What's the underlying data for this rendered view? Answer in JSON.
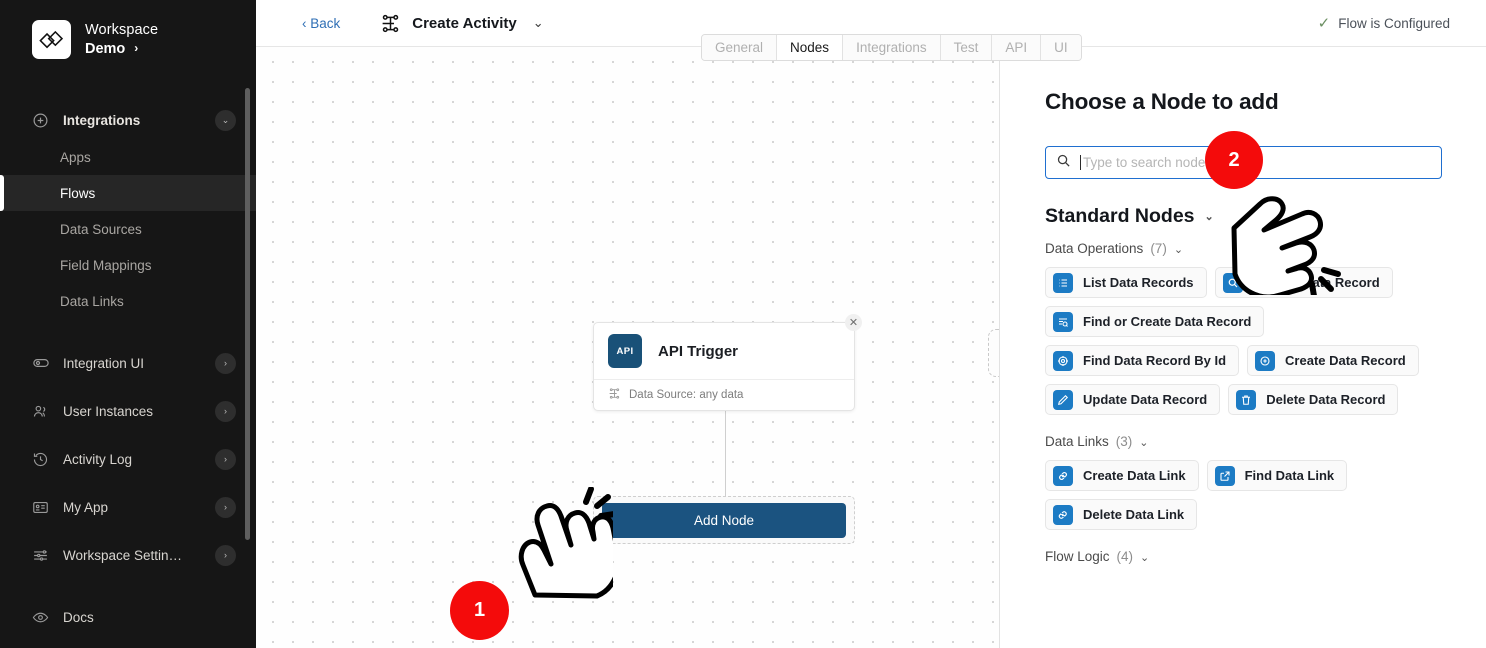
{
  "sidebar": {
    "workspace": {
      "label": "Workspace",
      "name": "Demo",
      "caret": "›",
      "logo_icon": "diamond-logo-icon"
    },
    "groups": [
      {
        "label": "Integrations",
        "icon": "plus-circle-icon",
        "chevron": "⌄",
        "items": [
          {
            "label": "Apps",
            "active": false
          },
          {
            "label": "Flows",
            "active": true
          },
          {
            "label": "Data Sources",
            "active": false
          },
          {
            "label": "Field Mappings",
            "active": false
          },
          {
            "label": "Data Links",
            "active": false
          }
        ]
      }
    ],
    "items": [
      {
        "label": "Integration UI",
        "icon": "toggle-icon",
        "chevron": "›"
      },
      {
        "label": "User Instances",
        "icon": "users-icon",
        "chevron": "›"
      },
      {
        "label": "Activity Log",
        "icon": "history-icon",
        "chevron": "›"
      },
      {
        "label": "My App",
        "icon": "id-card-icon",
        "chevron": "›"
      },
      {
        "label": "Workspace Settin…",
        "icon": "sliders-icon",
        "chevron": "›"
      },
      {
        "label": "Docs",
        "icon": "eye-icon",
        "chevron": ""
      }
    ]
  },
  "topbar": {
    "back_label": "‹ Back",
    "activity_title": "Create Activity",
    "activity_icon": "org-chart-icon",
    "activity_caret": "⌄",
    "status_text": "Flow is Configured",
    "status_check": "✓"
  },
  "tabs": [
    {
      "label": "General",
      "active": false
    },
    {
      "label": "Nodes",
      "active": true
    },
    {
      "label": "Integrations",
      "active": false
    },
    {
      "label": "Test",
      "active": false
    },
    {
      "label": "API",
      "active": false
    },
    {
      "label": "UI",
      "active": false
    }
  ],
  "canvas": {
    "node": {
      "badge_text": "API",
      "title": "API Trigger",
      "subtitle": "Data Source: any data",
      "subtitle_icon": "node-tree-icon",
      "close_icon": "✕"
    },
    "add_node_label": "Add Node"
  },
  "panel": {
    "title": "Choose a Node to add",
    "search": {
      "placeholder": "Type to search nodes",
      "value": "",
      "icon": "search-icon"
    },
    "standard_nodes": {
      "label": "Standard Nodes",
      "chevron": "⌄"
    },
    "sections": [
      {
        "label": "Data Operations",
        "count": "(7)",
        "chevron": "⌄",
        "chips": [
          {
            "label": "List Data Records",
            "icon": "list-icon"
          },
          {
            "label": "Lookup Data Record",
            "icon": "search-icon"
          },
          {
            "label": "Find or Create Data Record",
            "icon": "find-create-icon"
          },
          {
            "label": "Find Data Record By Id",
            "icon": "target-icon"
          },
          {
            "label": "Create Data Record",
            "icon": "plus-circle-icon"
          },
          {
            "label": "Update Data Record",
            "icon": "pencil-icon"
          },
          {
            "label": "Delete Data Record",
            "icon": "trash-icon"
          }
        ]
      },
      {
        "label": "Data Links",
        "count": "(3)",
        "chevron": "⌄",
        "chips": [
          {
            "label": "Create Data Link",
            "icon": "link-icon"
          },
          {
            "label": "Find Data Link",
            "icon": "external-link-icon"
          },
          {
            "label": "Delete Data Link",
            "icon": "link-break-icon"
          }
        ]
      },
      {
        "label": "Flow Logic",
        "count": "(4)",
        "chevron": "⌄",
        "chips": []
      }
    ]
  },
  "callouts": [
    {
      "number": "1",
      "target": "add-node-button"
    },
    {
      "number": "2",
      "target": "search-input"
    }
  ],
  "colors": {
    "accent_blue": "#1c7bc4",
    "button_blue": "#1b5380",
    "badge_red": "#f40b0b",
    "sidebar_bg": "#161616",
    "focus_border": "#1f6fd0"
  }
}
